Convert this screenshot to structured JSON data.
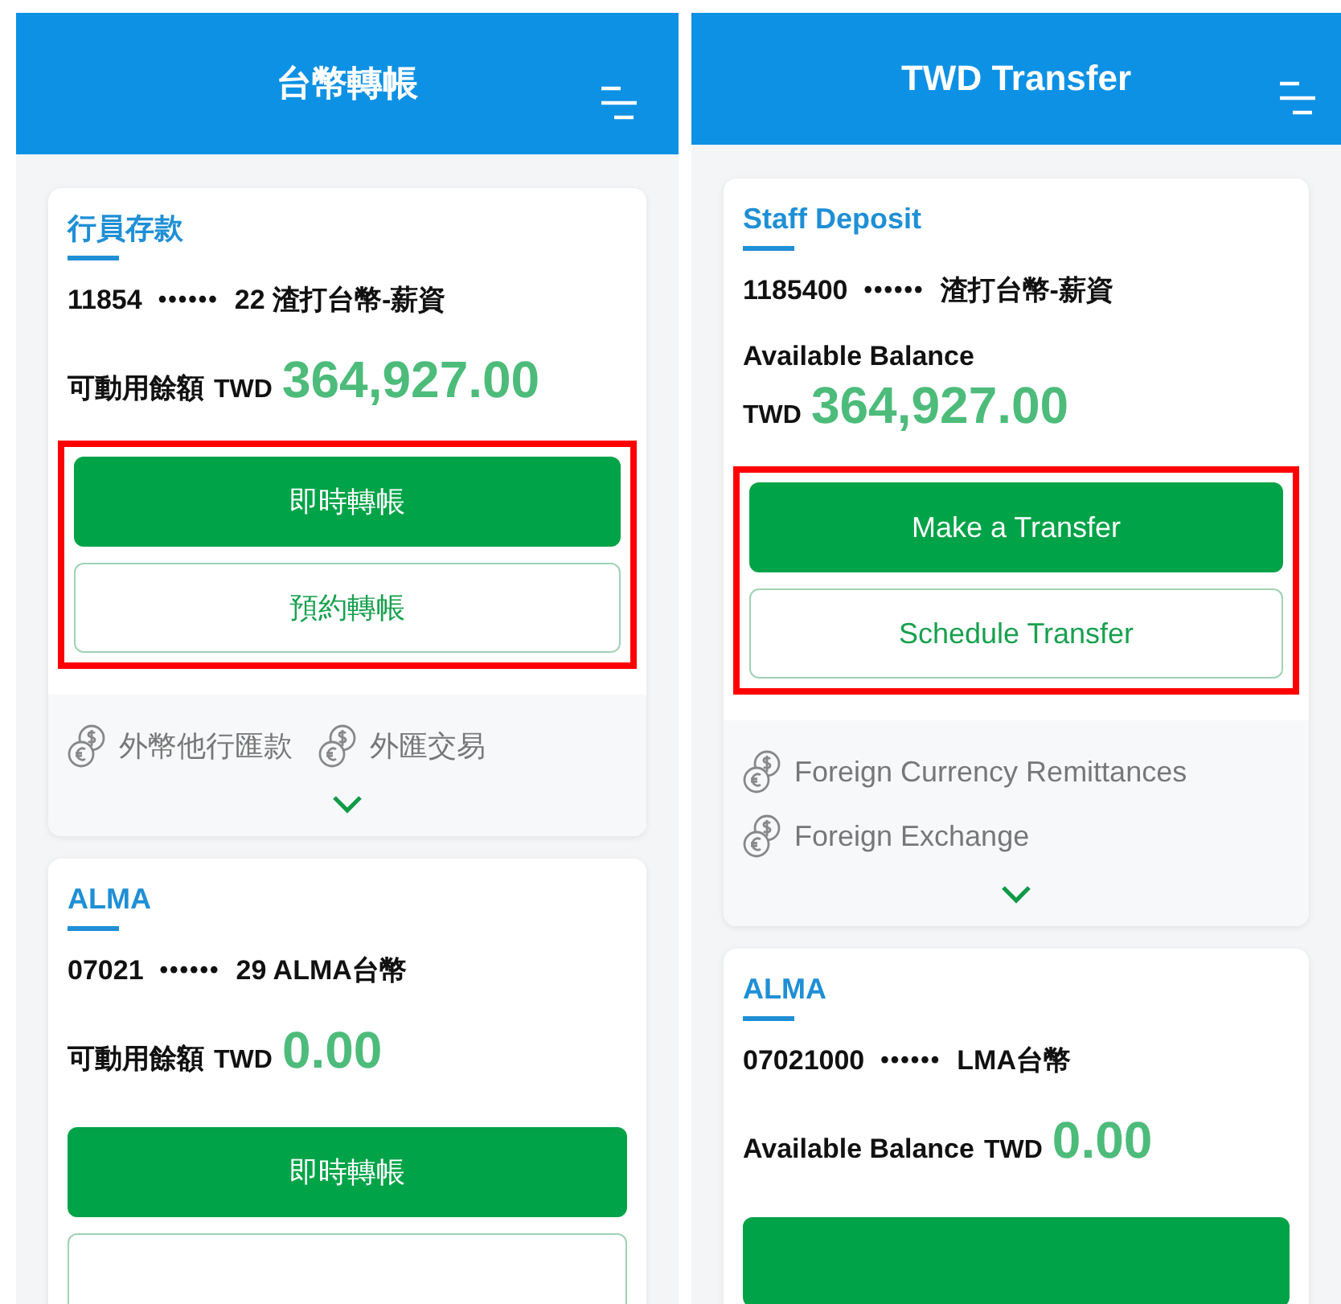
{
  "screens": [
    {
      "title": "台幣轉帳",
      "accounts": [
        {
          "name": "行員存款",
          "number_prefix": "11854",
          "masked": "••••••",
          "number_suffix": "22 渣打台幣-薪資",
          "balance_label": "可動用餘額",
          "currency": "TWD",
          "balance": "364,927.00",
          "highlighted": true,
          "buttons": [
            {
              "label": "即時轉帳",
              "kind": "primary"
            },
            {
              "label": "預約轉帳",
              "kind": "outline"
            }
          ],
          "services": [
            "外幣他行匯款",
            "外匯交易"
          ]
        },
        {
          "name": "ALMA",
          "number_prefix": "07021",
          "masked": "••••••",
          "number_suffix": "29 ALMA台幣",
          "balance_label": "可動用餘額",
          "currency": "TWD",
          "balance": "0.00",
          "highlighted": false,
          "buttons": [
            {
              "label": "即時轉帳",
              "kind": "primary"
            },
            {
              "kind": "outline"
            }
          ]
        }
      ]
    },
    {
      "title": "TWD Transfer",
      "accounts": [
        {
          "name": "Staff Deposit",
          "number_prefix": "1185400",
          "masked": "••••••",
          "number_suffix": "渣打台幣-薪資",
          "balance_label": "Available Balance",
          "currency": "TWD",
          "balance": "364,927.00",
          "highlighted": true,
          "buttons": [
            {
              "label": "Make a Transfer",
              "kind": "primary"
            },
            {
              "label": "Schedule Transfer",
              "kind": "outline"
            }
          ],
          "services": [
            "Foreign Currency Remittances",
            "Foreign Exchange"
          ]
        },
        {
          "name": "ALMA",
          "number_prefix": "07021000",
          "masked": "••••••",
          "number_suffix": "LMA台幣",
          "balance_label": "Available Balance",
          "currency": "TWD",
          "balance": "0.00",
          "highlighted": false,
          "buttons": [
            {
              "kind": "primary"
            }
          ]
        }
      ]
    }
  ]
}
